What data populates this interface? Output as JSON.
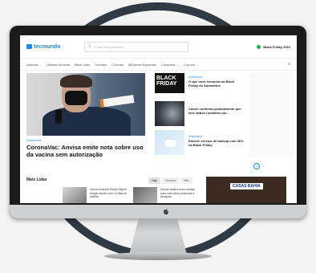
{
  "colors": {
    "ring": "#2f3a44",
    "accent": "#1e88e5",
    "promo_dot": "#1fae5b"
  },
  "header": {
    "logo": "tecmundo",
    "search_placeholder": "O que você procura?",
    "promo": "Black Friday 2020"
  },
  "nav": {
    "items": [
      "Notícias",
      "Últimas Notícias",
      "Mais Lidas",
      "Tutoriais",
      "Colunas",
      "AllXpress Especiais",
      "Comparar",
      "Cupons"
    ],
    "icons": [
      "chevron-down-icon",
      "grid-icon"
    ]
  },
  "main": {
    "category": "Pandemia",
    "title": "CoronaVac: Anvisa emite nota sobre uso da vacina sem autorização"
  },
  "side": {
    "thumb1_text": "BLACK FRIDAY",
    "items": [
      {
        "category": "Submarino",
        "title": "O que você encontra na Black Friday do Submarino"
      },
      {
        "category": "",
        "title": "Canon confirma publicamente que teve dados roubados por..."
      },
      {
        "category": "Segurança",
        "title": "Easeiit: serviço de backup com 50% na Black Friday"
      }
    ]
  },
  "pager": {
    "current": "1"
  },
  "mais_lidas": {
    "title": "Mais Lidas",
    "tabs": [
      "Hoje",
      "Semana",
      "Mês"
    ],
    "items": [
      "Xiaomi anuncia Redmi Watch, relógio barato com 12 dias de bateria",
      "Garoto destrói micro-ondas para criar arma poderosa e perigosa"
    ]
  },
  "ad": {
    "brand": "CASAS BAHIA"
  }
}
